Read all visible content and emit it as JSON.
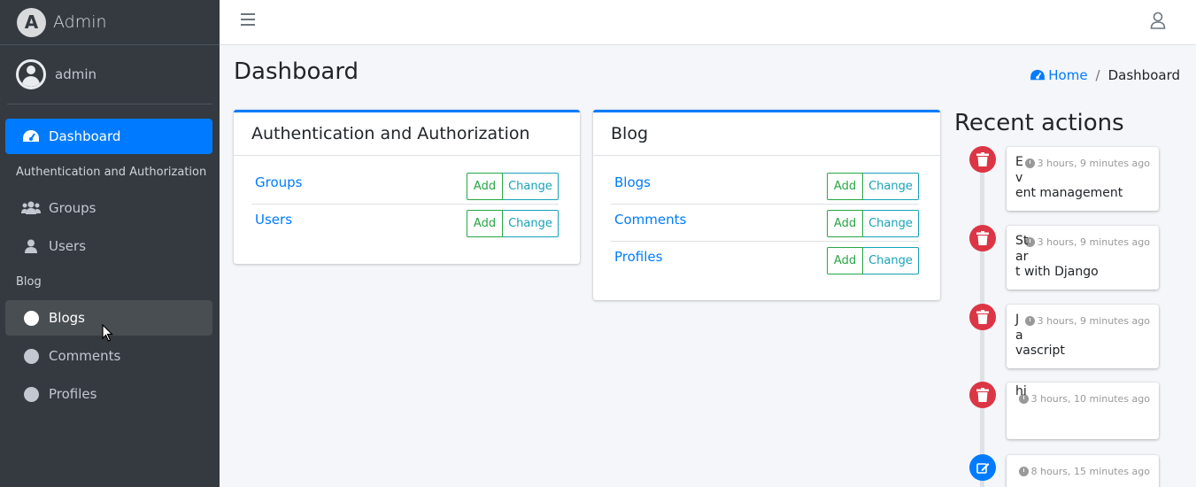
{
  "brand": {
    "logo_letter": "A",
    "title": "Admin"
  },
  "user": {
    "name": "admin"
  },
  "sidebar": {
    "dashboard": "Dashboard",
    "section_auth": "Authentication and Authorization",
    "groups": "Groups",
    "users": "Users",
    "section_blog": "Blog",
    "blogs": "Blogs",
    "comments": "Comments",
    "profiles": "Profiles"
  },
  "page": {
    "title": "Dashboard"
  },
  "breadcrumb": {
    "home": "Home",
    "separator": "/",
    "current": "Dashboard"
  },
  "apps": [
    {
      "name": "Authentication and Authorization",
      "models": [
        {
          "name": "Groups",
          "add": "Add",
          "change": "Change"
        },
        {
          "name": "Users",
          "add": "Add",
          "change": "Change"
        }
      ]
    },
    {
      "name": "Blog",
      "models": [
        {
          "name": "Blogs",
          "add": "Add",
          "change": "Change"
        },
        {
          "name": "Comments",
          "add": "Add",
          "change": "Change"
        },
        {
          "name": "Profiles",
          "add": "Add",
          "change": "Change"
        }
      ]
    }
  ],
  "recent_actions": {
    "title": "Recent actions",
    "items": [
      {
        "type": "delete",
        "time": "3 hours, 9 minutes ago",
        "lines": [
          "E",
          "v",
          "ent management"
        ]
      },
      {
        "type": "delete",
        "time": "3 hours, 9 minutes ago",
        "lines": [
          "St",
          "ar",
          "t with Django"
        ]
      },
      {
        "type": "delete",
        "time": "3 hours, 9 minutes ago",
        "lines": [
          "J",
          "a",
          "vascript"
        ]
      },
      {
        "type": "delete",
        "time": "3 hours, 10 minutes ago",
        "lines": [
          "",
          "",
          "hi"
        ]
      },
      {
        "type": "change",
        "time": "8 hours, 15 minutes ago",
        "lines": [
          "",
          "",
          ""
        ]
      }
    ]
  },
  "colors": {
    "sidebar_bg": "#343a40",
    "primary": "#007bff",
    "success": "#28a745",
    "info": "#17a2b8",
    "danger": "#dc3545"
  }
}
